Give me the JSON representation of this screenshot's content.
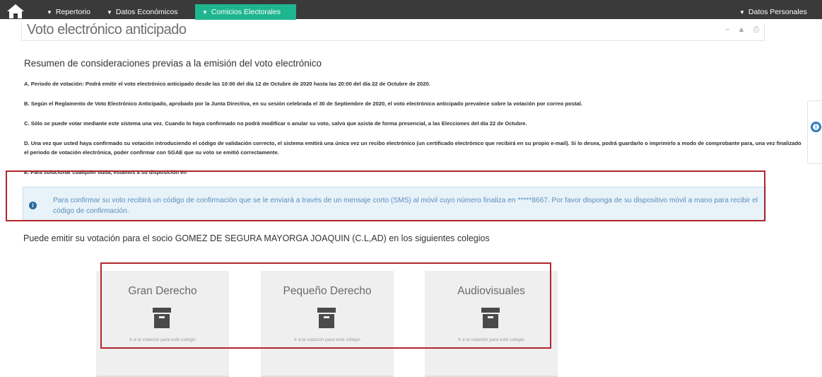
{
  "nav": {
    "items": [
      {
        "label": "Repertorio"
      },
      {
        "label": "Datos Económicos"
      },
      {
        "label": "Comicios Electorales"
      }
    ],
    "right_item": {
      "label": "Datos Personales"
    },
    "accent_color": "#1fb58f"
  },
  "page": {
    "title": "Voto electrónico anticipado",
    "header_tools": [
      "−",
      "▲",
      "⎙"
    ]
  },
  "summary": {
    "title": "Resumen de consideraciones previas a la emisión del voto electrónico",
    "items": [
      "A. Periodo de votación: Podrá emitir el voto electrónico anticipado desde las 10:00 del día 12 de Octubre de 2020 hasta las 20:00 del día 22 de Octubre de 2020.",
      "B. Según el Reglamento de Voto Electrónico Anticipado, aprobado por la Junta Directiva, en su sesión celebrada el 30 de Septiembre de 2020, el voto electrónico anticipado prevalece sobre la votación por correo postal.",
      "C. Sólo se puede votar mediante este sistema una vez. Cuando lo haya confirmado no podrá modificar o anular su voto, salvo que asista de forma presencial, a las Elecciones del día 22 de Octubre.",
      "D. Una vez que usted haya confirmado su votación introduciendo el código de validación correcto, el sistema emitirá una única vez un recibo electrónico (un certificado electrónico que recibirá en su propio e-mail). Si lo desea, podrá guardarlo o imprimirlo a modo de comprobante para, una vez finalizado el periodo de votación electrónica, poder confirmar con SGAE que su voto se emitió correctamente.",
      "E. Para solucionar cualquier duda, estamos a su disposición en"
    ]
  },
  "alert": {
    "icon": "info-icon",
    "text": "Para confirmar su voto recibirá un código de confirmación que se le enviará a través de un mensaje corto (SMS) al móvil cuyo número finaliza en *****8667. Por favor disponga de su dispositivo móvil a mano para recibir el código de confirmación."
  },
  "voting": {
    "title": "Puede emitir su votación para el socio GOMEZ DE SEGURA MAYORGA JOAQUIN (C.L,AD) en los siguientes colegios",
    "cards": [
      {
        "title": "Gran Derecho",
        "icon": "ballot-box-icon",
        "note": "Ir a la votación para este colegio"
      },
      {
        "title": "Pequeño Derecho",
        "icon": "ballot-box-icon",
        "note": "Ir a la votación para este colegio"
      },
      {
        "title": "Audiovisuales",
        "icon": "ballot-box-icon",
        "note": "Ir a la votación para este colegio"
      }
    ]
  },
  "highlight_color": "#b0272d"
}
